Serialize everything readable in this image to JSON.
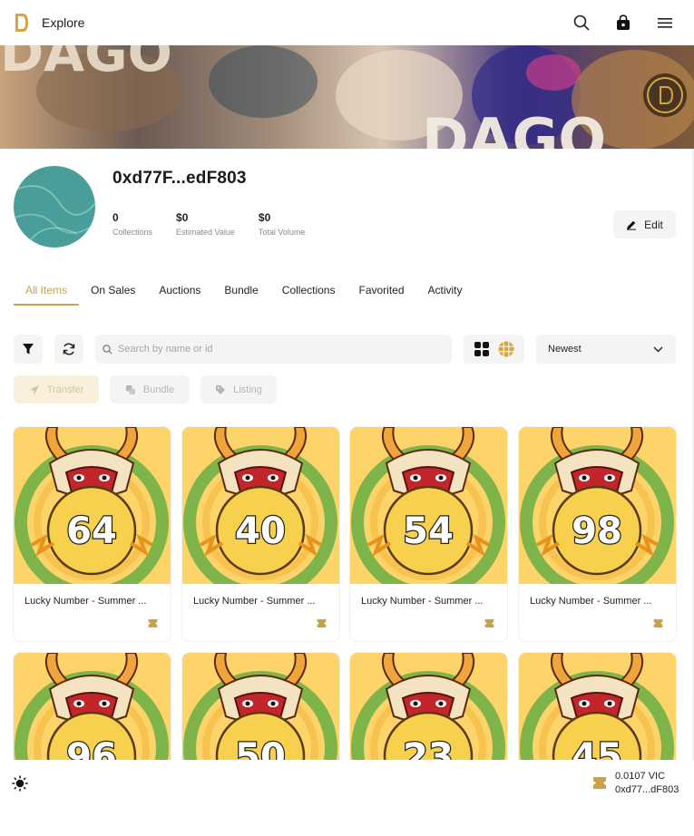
{
  "header": {
    "brand": "Explore"
  },
  "profile": {
    "address": "0xd77F...edF803",
    "stats": [
      {
        "value": "0",
        "label": "Collections"
      },
      {
        "value": "$0",
        "label": "Estimated Value"
      },
      {
        "value": "$0",
        "label": "Total Volume"
      }
    ],
    "edit_label": "Edit"
  },
  "banner": {
    "text": "DAGO"
  },
  "tabs": [
    "All Items",
    "On Sales",
    "Auctions",
    "Bundle",
    "Collections",
    "Favorited",
    "Activity"
  ],
  "active_tab": "All Items",
  "toolbar": {
    "search_placeholder": "Search by name or id",
    "sort_value": "Newest",
    "actions": [
      "Transfer",
      "Bundle",
      "Listing"
    ]
  },
  "items": [
    {
      "number": "64",
      "name": "Lucky Number - Summer ..."
    },
    {
      "number": "40",
      "name": "Lucky Number - Summer ..."
    },
    {
      "number": "54",
      "name": "Lucky Number - Summer ..."
    },
    {
      "number": "98",
      "name": "Lucky Number - Summer ..."
    },
    {
      "number": "96",
      "name": ""
    },
    {
      "number": "50",
      "name": ""
    },
    {
      "number": "23",
      "name": ""
    },
    {
      "number": "45",
      "name": ""
    }
  ],
  "footer": {
    "balance": "0.0107 VIC",
    "address": "0xd77...dF803"
  },
  "colors": {
    "accent": "#c9a24b",
    "card_bg": "#fcd46a",
    "ring": "#7fb44a",
    "dragon": "#c2262b"
  },
  "icons": [
    "search-icon",
    "bag-icon",
    "menu-icon",
    "filter-icon",
    "refresh-icon",
    "grid-large-icon",
    "grid-small-icon",
    "chevron-down-icon",
    "send-icon",
    "bundle-icon",
    "tag-icon",
    "edit-icon",
    "sun-icon",
    "chain-icon"
  ]
}
